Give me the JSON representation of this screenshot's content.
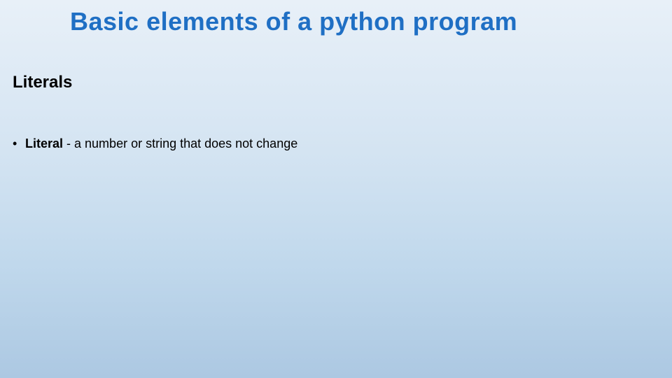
{
  "slide": {
    "title": "Basic elements of a python program",
    "section_heading": "Literals",
    "bullets": [
      {
        "term": "Literal",
        "definition": " - a number or string that does not change"
      }
    ]
  }
}
